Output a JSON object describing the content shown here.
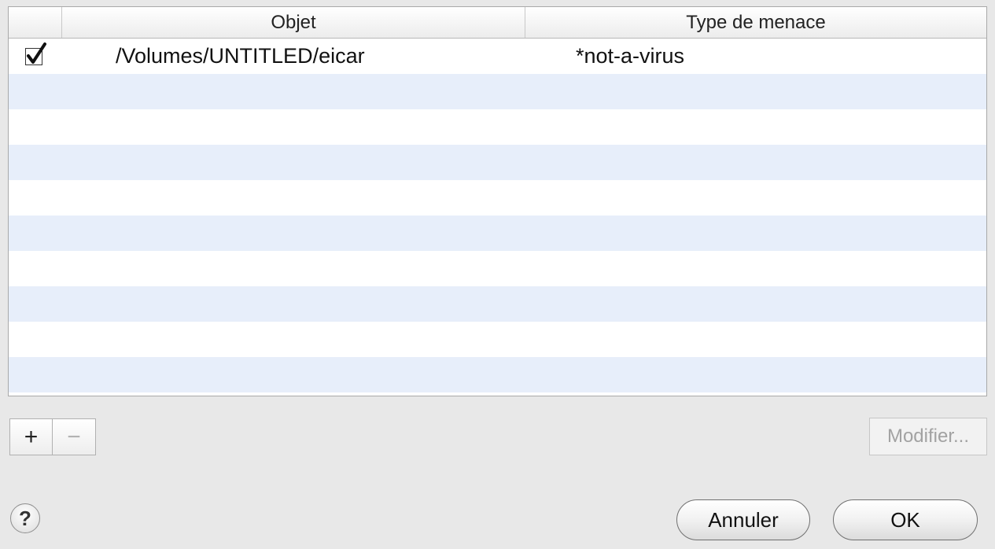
{
  "table": {
    "columns": [
      "",
      "Objet",
      "Type de menace"
    ],
    "rows": [
      {
        "checked": true,
        "object": "/Volumes/UNTITLED/eicar",
        "threat": "*not-a-virus"
      }
    ],
    "empty_rows": 9
  },
  "toolbar": {
    "add_label": "+",
    "remove_label": "−",
    "modify_label": "Modifier..."
  },
  "help": {
    "label": "?"
  },
  "buttons": {
    "cancel_label": "Annuler",
    "ok_label": "OK"
  },
  "colors": {
    "row_alt": "#e7eefa",
    "dialog_bg": "#e8e8e8"
  }
}
